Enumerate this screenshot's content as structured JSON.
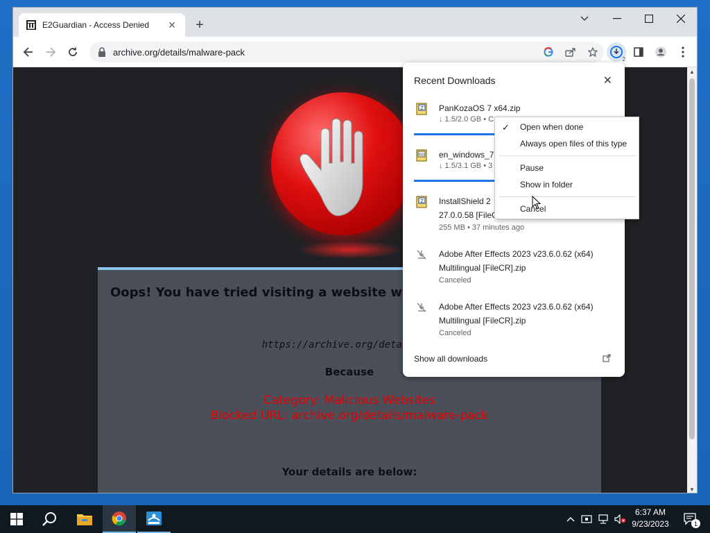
{
  "browser": {
    "tab_title": "E2Guardian - Access Denied",
    "url": "archive.org/details/malware-pack",
    "download_badge_count": "2"
  },
  "page": {
    "headline": "Oops! You have tried visiting a website which ha",
    "blocked_url_italic": "https://archive.org/details/ma",
    "because": "Because",
    "category": "Category: Malicious Websites",
    "blocked_url_line": "Blocked URL: archive.org/details/malware-pack",
    "details": "Your details are below:"
  },
  "downloads": {
    "title": "Recent Downloads",
    "items": [
      {
        "name": "PanKozaOS 7 x64.zip",
        "status": "↓ 1.5/2.0 GB • C",
        "icon": "zip-file-icon",
        "progress": 0.75
      },
      {
        "name": "en_windows_7",
        "status": "↓ 1.5/3.1 GB • 3",
        "icon": "iso-file-icon",
        "progress": 0.48
      },
      {
        "name": "InstallShield 2",
        "name2": "27.0.0.58 [FileC",
        "status": "255 MB • 37 minutes ago",
        "icon": "zip-file-icon"
      },
      {
        "name": "Adobe After Effects 2023 v23.6.0.62 (x64)",
        "name2": "Multilingual [FileCR].zip",
        "status": "Canceled",
        "icon": "canceled-download-icon"
      },
      {
        "name": "Adobe After Effects 2023 v23.6.0.62 (x64)",
        "name2": "Multilingual [FileCR].zip",
        "status": "Canceled",
        "icon": "canceled-download-icon"
      }
    ],
    "show_all": "Show all downloads"
  },
  "context_menu": {
    "open_when_done": "Open when done",
    "always_open": "Always open files of this type",
    "pause": "Pause",
    "show_in_folder": "Show in folder",
    "cancel": "Cancel"
  },
  "taskbar": {
    "time": "6:37 AM",
    "date": "9/23/2023",
    "notification_count": "1"
  },
  "colors": {
    "accent": "#1a73e8",
    "block_red": "#e60000",
    "page_bg": "#202124"
  }
}
